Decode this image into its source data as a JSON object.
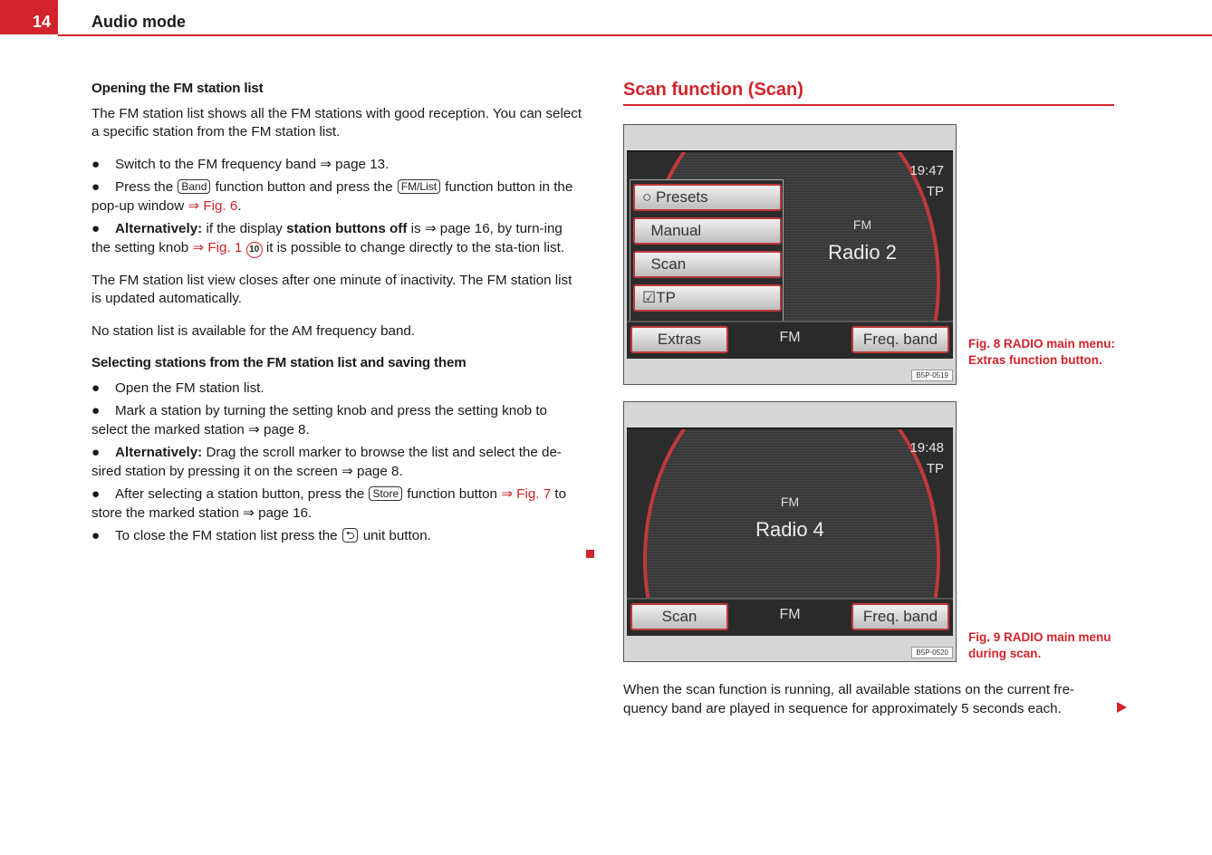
{
  "header": {
    "page_number": "14",
    "chapter_title": "Audio mode"
  },
  "left": {
    "section1": {
      "heading": "Opening the FM station list",
      "intro": "The FM station list shows all the FM stations with good reception. You can select a specific station from the FM station list.",
      "bullet1": {
        "text": "Switch to the FM frequency band ⇒ page 13."
      },
      "bullet2": {
        "pre": "Press the ",
        "key1": "Band",
        "mid": " function button and press the ",
        "key2": "FM/List",
        "post": " function button in the pop-up window ",
        "ref": "⇒ Fig. 6",
        "end": "."
      },
      "bullet3": {
        "bold1": "Alternatively:",
        "t1": " if the display ",
        "bold2": "station buttons off",
        "t2": " is ⇒ page 16, by turn-ing the setting knob ",
        "ref": "⇒ Fig. 1",
        "circ": "10",
        "t3": " it is possible to change directly to the sta-tion list."
      },
      "para2": "The FM station list view closes after one minute of inactivity. The FM station list is updated automatically.",
      "para3": "No station list is available for the AM frequency band."
    },
    "section2": {
      "heading": "Selecting stations from the FM station list and saving them",
      "bullet1": "Open the FM station list.",
      "bullet2": "Mark a station by turning the setting knob and press the setting knob to select the marked station ⇒ page 8.",
      "bullet3": {
        "bold": "Alternatively:",
        "text": " Drag the scroll marker to browse the list and select the de-sired station by pressing it on the screen ⇒ page 8."
      },
      "bullet4": {
        "pre": "After selecting a station button, press the ",
        "key": "Store",
        "mid": " function button ",
        "ref": "⇒ Fig. 7",
        "post": " to store the marked station ⇒ page 16."
      },
      "bullet5": {
        "pre": "To close the FM station list press the ",
        "icon": "return-icon",
        "post": " unit button."
      }
    }
  },
  "right": {
    "section_title": "Scan function (Scan)",
    "fig8": {
      "time": "19:47",
      "tp": "TP",
      "band": "FM",
      "station": "Radio 2",
      "popup": [
        "Presets",
        "Manual",
        "Scan",
        "TP"
      ],
      "btn_left": "Extras",
      "bar_mid": "FM",
      "btn_right": "Freq. band",
      "code": "B5P-0519",
      "caption": "Fig. 8   RADIO main menu: Extras function button."
    },
    "fig9": {
      "time": "19:48",
      "tp": "TP",
      "band": "FM",
      "station": "Radio 4",
      "btn_left": "Scan",
      "bar_mid": "FM",
      "btn_right": "Freq. band",
      "code": "B5P-0520",
      "caption": "Fig. 9   RADIO main menu during scan."
    },
    "paragraph": "When the scan function is running, all available stations on the current fre-quency band are played in sequence for approximately 5 seconds each."
  },
  "colors": {
    "accent": "#d2232a"
  }
}
